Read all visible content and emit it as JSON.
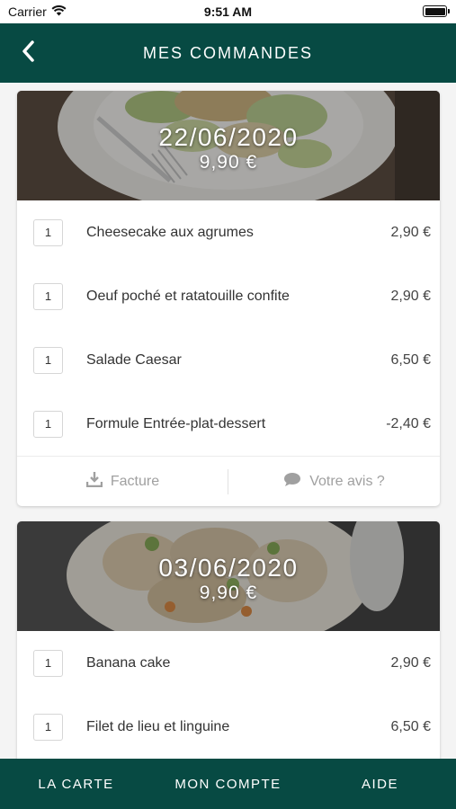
{
  "status_bar": {
    "carrier": "Carrier",
    "time": "9:51 AM",
    "icons": [
      "wifi-icon",
      "battery-icon"
    ]
  },
  "header": {
    "title": "MES COMMANDES",
    "back_icon": "chevron-left-icon"
  },
  "colors": {
    "primary": "#074a43",
    "background": "#f4f4f4",
    "card": "#ffffff",
    "muted": "#a0a0a0"
  },
  "orders": [
    {
      "date": "22/06/2020",
      "total": "9,90 €",
      "image": "caesar-salad-photo",
      "items": [
        {
          "qty": "1",
          "name": "Cheesecake aux agrumes",
          "price": "2,90 €"
        },
        {
          "qty": "1",
          "name": "Oeuf poché et ratatouille confite",
          "price": "2,90 €"
        },
        {
          "qty": "1",
          "name": "Salade Caesar",
          "price": "6,50 €"
        },
        {
          "qty": "1",
          "name": "Formule Entrée-plat-dessert",
          "price": "-2,40 €"
        }
      ],
      "actions": {
        "invoice": "Facture",
        "invoice_icon": "download-icon",
        "review": "Votre avis ?",
        "review_icon": "speech-bubble-icon"
      }
    },
    {
      "date": "03/06/2020",
      "total": "9,90 €",
      "image": "pasta-shells-photo",
      "items": [
        {
          "qty": "1",
          "name": "Banana cake",
          "price": "2,90 €"
        },
        {
          "qty": "1",
          "name": "Filet de lieu et linguine",
          "price": "6,50 €"
        }
      ]
    }
  ],
  "bottom_nav": {
    "items": [
      "LA CARTE",
      "MON COMPTE",
      "AIDE"
    ]
  }
}
